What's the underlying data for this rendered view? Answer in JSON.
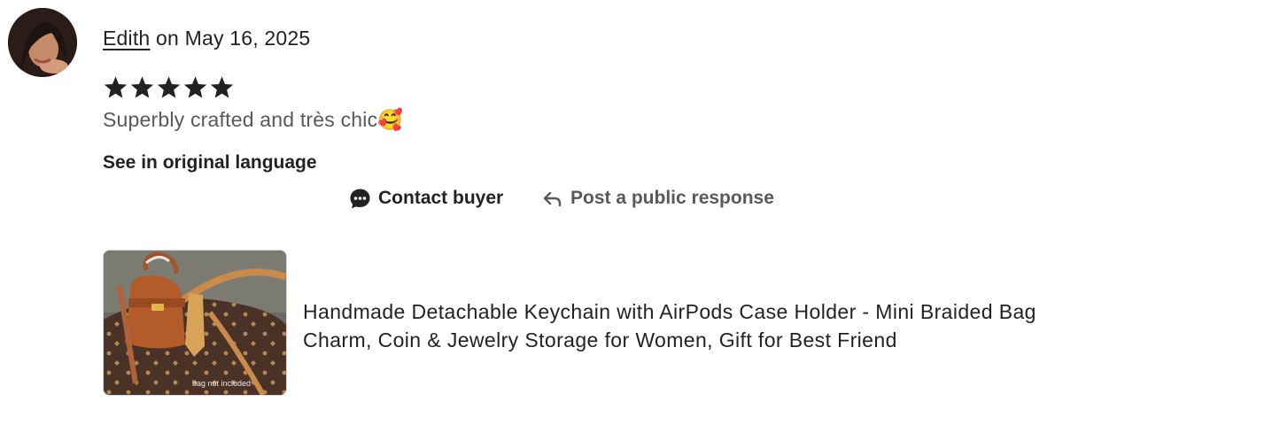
{
  "review": {
    "reviewer_name": "Edith",
    "date_text": "on May 16, 2025",
    "rating": 5,
    "rating_max": 5,
    "text": "Superbly crafted and très chic🥰",
    "see_original_label": "See in original language"
  },
  "actions": {
    "contact_label": "Contact buyer",
    "respond_label": "Post a public response"
  },
  "listing": {
    "title": "Handmade Detachable Keychain with AirPods Case Holder - Mini Braided Bag Charm, Coin & Jewelry Storage for Women, Gift for Best Friend",
    "image_caption": "bag not included"
  },
  "colors": {
    "text_primary": "#222222",
    "text_secondary": "#595959",
    "star": "#222222"
  },
  "icons": {
    "contact": "chat-bubble-icon",
    "respond": "reply-arrow-icon",
    "star": "star-icon"
  }
}
